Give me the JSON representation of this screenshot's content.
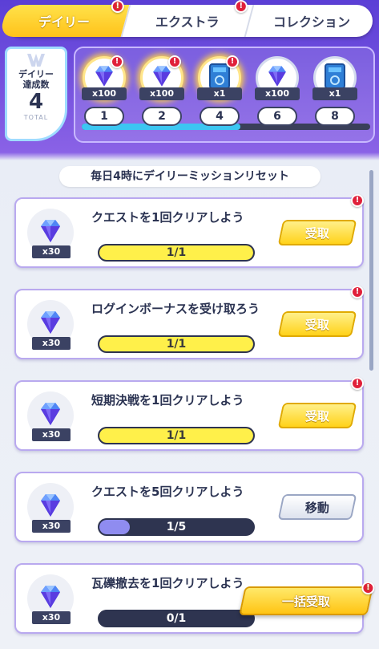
{
  "tabs": [
    {
      "label": "デイリー",
      "active": true,
      "alert": true
    },
    {
      "label": "エクストラ",
      "active": false,
      "alert": true
    },
    {
      "label": "コレクション",
      "active": false,
      "alert": false
    }
  ],
  "streak": {
    "label_line1": "デイリー",
    "label_line2": "達成数",
    "count": "4",
    "total_label": "TOTAL"
  },
  "progress_fraction": 0.55,
  "rewards": [
    {
      "icon": "diamond-icon",
      "qty": "x100",
      "step": "1",
      "claimed": true,
      "alert": true
    },
    {
      "icon": "diamond-icon",
      "qty": "x100",
      "step": "2",
      "claimed": true,
      "alert": true
    },
    {
      "icon": "ticket-icon",
      "qty": "x1",
      "step": "4",
      "claimed": true,
      "alert": true
    },
    {
      "icon": "diamond-icon",
      "qty": "x100",
      "step": "6",
      "claimed": false,
      "alert": false
    },
    {
      "icon": "ticket-icon",
      "qty": "x1",
      "step": "8",
      "claimed": false,
      "alert": false
    }
  ],
  "reset_text": "毎日4時にデイリーミッションリセット",
  "missions": [
    {
      "title": "クエストを1回クリアしよう",
      "reward_qty": "x30",
      "progress_text": "1/1",
      "progress": 1.0,
      "action": "受取",
      "action_type": "claim",
      "alert": true
    },
    {
      "title": "ログインボーナスを受け取ろう",
      "reward_qty": "x30",
      "progress_text": "1/1",
      "progress": 1.0,
      "action": "受取",
      "action_type": "claim",
      "alert": true
    },
    {
      "title": "短期決戦を1回クリアしよう",
      "reward_qty": "x30",
      "progress_text": "1/1",
      "progress": 1.0,
      "action": "受取",
      "action_type": "claim",
      "alert": true
    },
    {
      "title": "クエストを5回クリアしよう",
      "reward_qty": "x30",
      "progress_text": "1/5",
      "progress": 0.2,
      "action": "移動",
      "action_type": "go",
      "alert": false
    },
    {
      "title": "瓦礫撤去を1回クリアしよう",
      "reward_qty": "x30",
      "progress_text": "0/1",
      "progress": 0.0,
      "action": "",
      "action_type": "none",
      "alert": false
    }
  ],
  "bulk_claim_label": "一括受取",
  "colors": {
    "accent_yellow": "#ffd21a",
    "header_purple": "#5b3fd6",
    "track_fill": "#3cc6f2"
  }
}
